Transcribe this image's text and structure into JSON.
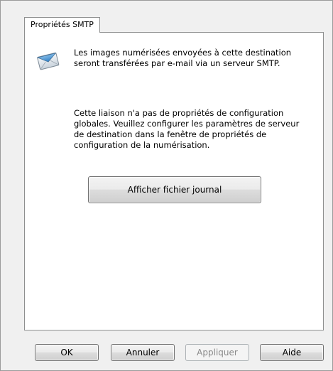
{
  "tab": {
    "label": "Propriétés SMTP"
  },
  "panel": {
    "icon": "envelope-icon",
    "intro": "Les images numérisées envoyées à cette destination seront transférées par e-mail via un serveur SMTP.",
    "description": "Cette liaison n'a pas de propriétés de configuration globales. Veuillez configurer les paramètres de serveur de destination dans la fenêtre de propriétés de configuration de la numérisation.",
    "log_button_label": "Afficher fichier journal"
  },
  "buttons": {
    "ok": "OK",
    "cancel": "Annuler",
    "apply": "Appliquer",
    "help": "Aide"
  },
  "colors": {
    "dialog_background": "#f0f0f0",
    "panel_background": "#ffffff",
    "disabled_text": "#8a8a8a"
  }
}
